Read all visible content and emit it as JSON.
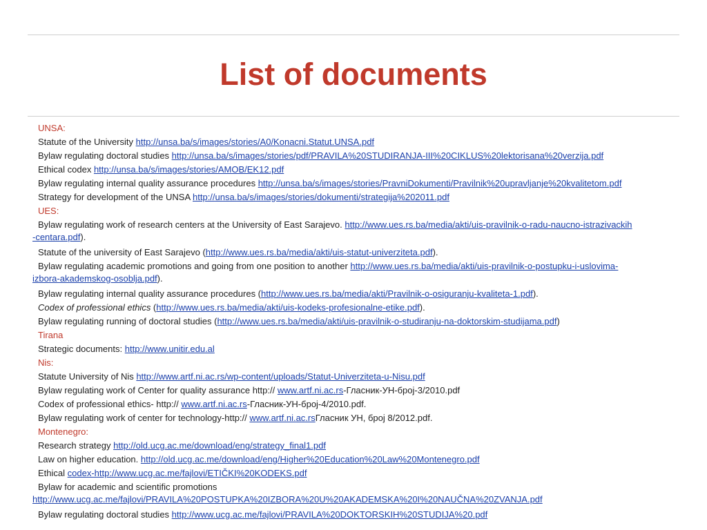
{
  "title": "List of documents",
  "lines": [
    {
      "type": "head",
      "text": "UNSA:"
    },
    {
      "text": "Statute of the University ",
      "link": "http://unsa.ba/s/images/stories/A0/Konacni.Statut.UNSA.pdf"
    },
    {
      "text": "Bylaw regulating doctoral studies ",
      "link": "http://unsa.ba/s/images/stories/pdf/PRAVILA%20STUDIRANJA-III%20CIKLUS%20lektorisana%20verzija.pdf"
    },
    {
      "text": "Ethical codex ",
      "link": "http://unsa.ba/s/images/stories/AMOB/EK12.pdf"
    },
    {
      "text": "Bylaw regulating internal quality assurance procedures ",
      "link": "http://unsa.ba/s/images/stories/PravniDokumenti/Pravilnik%20upravljanje%20kvalitetom.pdf"
    },
    {
      "text": "Strategy for development of the UNSA ",
      "link": "http://unsa.ba/s/images/stories/dokumenti/strategija%202011.pdf"
    },
    {
      "type": "head",
      "text": "UES:"
    },
    {
      "text": "Bylaw regulating work of research centers at the University of East Sarajevo. ",
      "link": "http://www.ues.rs.ba/media/akti/uis-pravilnik-o-radu-naucno-istrazivackih",
      "cont_link": "-centara.pdf",
      "cont_after": ")."
    },
    {
      "text": "Statute of the university of East Sarajevo (",
      "link": "http://www.ues.rs.ba/media/akti/uis-statut-univerziteta.pdf",
      "after": ")."
    },
    {
      "text": "Bylaw regulating academic promotions and going from one position to another ",
      "link": "http://www.ues.rs.ba/media/akti/uis-pravilnik-o-postupku-i-uslovima-",
      "cont_link": "izbora-akademskog-osoblja.pdf",
      "cont_after": ")."
    },
    {
      "text": "Bylaw regulating internal quality assurance procedures (",
      "link": "http://www.ues.rs.ba/media/akti/Pravilnik-o-osiguranju-kvaliteta-1.pdf",
      "after": ")."
    },
    {
      "italic": "Codex of professional ethics",
      "text": " (",
      "link": "http://www.ues.rs.ba/media/akti/uis-kodeks-profesionalne-etike.pdf",
      "after": ")."
    },
    {
      "text": "Bylaw regulating running of doctoral studies (",
      "link": "http://www.ues.rs.ba/media/akti/uis-pravilnik-o-studiranju-na-doktorskim-studijama.pdf",
      "after": ")"
    },
    {
      "type": "head",
      "text": "Tirana"
    },
    {
      "text": "Strategic documents: ",
      "link": "http://www.unitir.edu.al"
    },
    {
      "type": "head",
      "text": "Nis:"
    },
    {
      "text": "Statute University of Nis ",
      "link": "http://www.artf.ni.ac.rs/wp-content/uploads/Statut-Univerziteta-u-Nisu.pdf"
    },
    {
      "text": "Bylaw regulating work of Center for quality assurance http:// ",
      "link": "www.artf.ni.ac.rs",
      "after": "-Гласник-УН-број-3/2010.pdf"
    },
    {
      "text": "Codex of professional ethics- http:// ",
      "link": "www.artf.ni.ac.rs",
      "after": "-Гласник-УН-број-4/2010.pdf."
    },
    {
      "text": "Bylaw regulating work of center for technology-http:// ",
      "link": "www.artf.ni.ac.rs",
      "after": "Гласник УН, број 8/2012.pdf."
    },
    {
      "type": "head",
      "text": "Montenegro:"
    },
    {
      "text": "Research strategy ",
      "link": "http://old.ucg.ac.me/download/eng/strategy_final1.pdf"
    },
    {
      "text": "Law on higher education. ",
      "link": "http://old.ucg.ac.me/download/eng/Higher%20Education%20Law%20Montenegro.pdf"
    },
    {
      "text": "Ethical ",
      "link": "codex-http://www.ucg.ac.me/fajlovi/ETIČKI%20KODEKS.pdf"
    },
    {
      "text": "Bylaw for academic and scientific promotions",
      "cont_link": "http://www.ucg.ac.me/fajlovi/PRAVILA%20POSTUPKA%20IZBORA%20U%20AKADEMSKA%20I%20NAUČNA%20ZVANJA.pdf"
    },
    {
      "text": "Bylaw regulating doctoral studies ",
      "link": "http://www.ucg.ac.me/fajlovi/PRAVILA%20DOKTORSKIH%20STUDIJA%20.pdf"
    }
  ]
}
